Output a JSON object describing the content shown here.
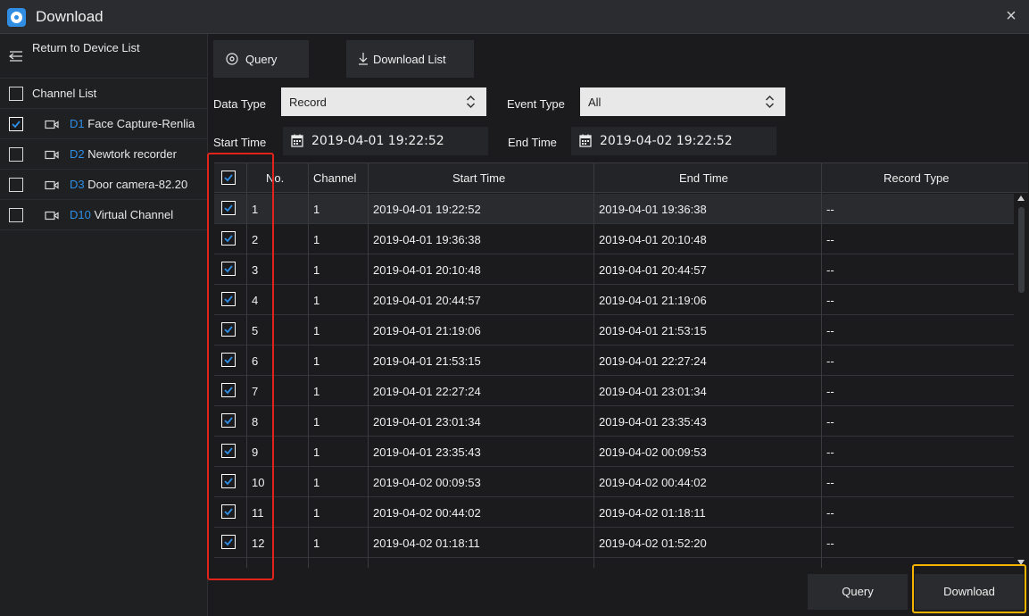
{
  "window": {
    "title": "Download",
    "close_glyph": "×"
  },
  "sidebar": {
    "return_label": "Return to Device List",
    "channel_list_label": "Channel List",
    "channels": [
      {
        "id": "D1",
        "name": "Face Capture-Renlia",
        "checked": true
      },
      {
        "id": "D2",
        "name": "Newtork recorder",
        "checked": false
      },
      {
        "id": "D3",
        "name": "Door camera-82.20",
        "checked": false
      },
      {
        "id": "D10",
        "name": "Virtual Channel",
        "checked": false
      }
    ]
  },
  "tabs": {
    "query": "Query",
    "download_list": "Download List"
  },
  "filters": {
    "data_type_label": "Data Type",
    "data_type_value": "Record",
    "event_type_label": "Event Type",
    "event_type_value": "All",
    "start_time_label": "Start Time",
    "start_time_value": "2019-04-01 19:22:52",
    "end_time_label": "End Time",
    "end_time_value": "2019-04-02 19:22:52"
  },
  "table": {
    "headers": {
      "no": "No.",
      "channel": "Channel",
      "start": "Start Time",
      "end": "End Time",
      "record_type": "Record Type"
    },
    "rows": [
      {
        "no": "1",
        "channel": "1",
        "start": "2019-04-01 19:22:52",
        "end": "2019-04-01 19:36:38",
        "type": "--"
      },
      {
        "no": "2",
        "channel": "1",
        "start": "2019-04-01 19:36:38",
        "end": "2019-04-01 20:10:48",
        "type": "--"
      },
      {
        "no": "3",
        "channel": "1",
        "start": "2019-04-01 20:10:48",
        "end": "2019-04-01 20:44:57",
        "type": "--"
      },
      {
        "no": "4",
        "channel": "1",
        "start": "2019-04-01 20:44:57",
        "end": "2019-04-01 21:19:06",
        "type": "--"
      },
      {
        "no": "5",
        "channel": "1",
        "start": "2019-04-01 21:19:06",
        "end": "2019-04-01 21:53:15",
        "type": "--"
      },
      {
        "no": "6",
        "channel": "1",
        "start": "2019-04-01 21:53:15",
        "end": "2019-04-01 22:27:24",
        "type": "--"
      },
      {
        "no": "7",
        "channel": "1",
        "start": "2019-04-01 22:27:24",
        "end": "2019-04-01 23:01:34",
        "type": "--"
      },
      {
        "no": "8",
        "channel": "1",
        "start": "2019-04-01 23:01:34",
        "end": "2019-04-01 23:35:43",
        "type": "--"
      },
      {
        "no": "9",
        "channel": "1",
        "start": "2019-04-01 23:35:43",
        "end": "2019-04-02 00:09:53",
        "type": "--"
      },
      {
        "no": "10",
        "channel": "1",
        "start": "2019-04-02 00:09:53",
        "end": "2019-04-02 00:44:02",
        "type": "--"
      },
      {
        "no": "11",
        "channel": "1",
        "start": "2019-04-02 00:44:02",
        "end": "2019-04-02 01:18:11",
        "type": "--"
      },
      {
        "no": "12",
        "channel": "1",
        "start": "2019-04-02 01:18:11",
        "end": "2019-04-02 01:52:20",
        "type": "--"
      }
    ]
  },
  "footer": {
    "query_label": "Query",
    "download_label": "Download"
  },
  "colors": {
    "accent": "#2d8fe8",
    "highlight_red": "#e0241b",
    "highlight_yellow": "#f4b400"
  }
}
